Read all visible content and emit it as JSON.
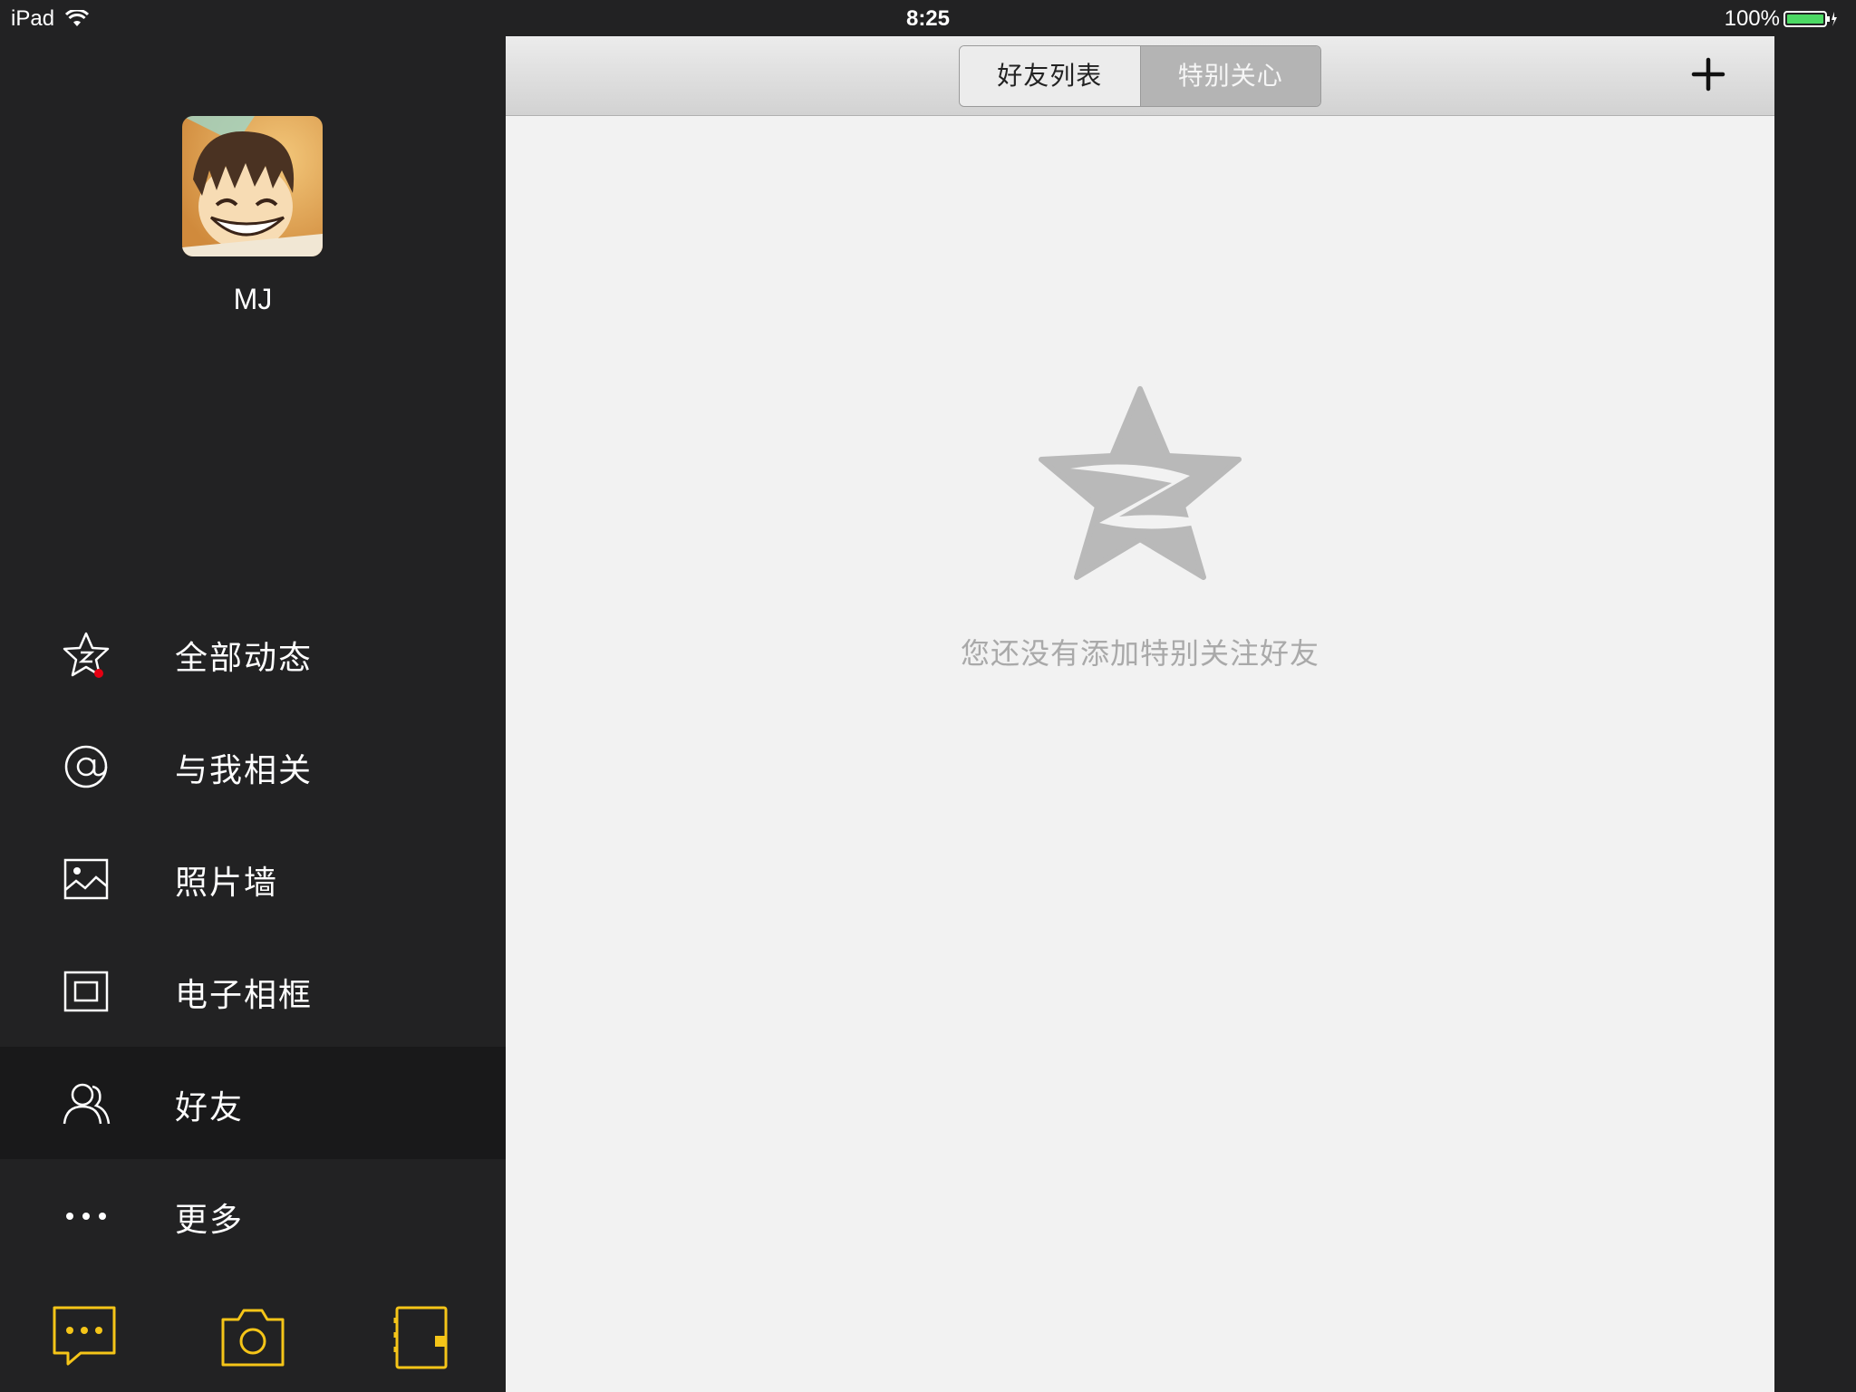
{
  "status_bar": {
    "device": "iPad",
    "time": "8:25",
    "battery": "100%"
  },
  "profile": {
    "name": "MJ"
  },
  "menu": [
    {
      "label": "全部动态",
      "icon": "qzone-star-icon",
      "badge": true
    },
    {
      "label": "与我相关",
      "icon": "at-icon"
    },
    {
      "label": "照片墙",
      "icon": "photo-icon"
    },
    {
      "label": "电子相框",
      "icon": "frame-icon"
    },
    {
      "label": "好友",
      "icon": "friends-icon",
      "active": true
    },
    {
      "label": "更多",
      "icon": "more-dots-icon"
    }
  ],
  "bottom_actions": [
    "compose-message-icon",
    "camera-icon",
    "notebook-icon"
  ],
  "tabs": {
    "friend_list": "好友列表",
    "special_care": "特别关心",
    "selected": "friend_list"
  },
  "empty_state": {
    "message": "您还没有添加特别关注好友"
  },
  "colors": {
    "accent": "#f5c518",
    "sidebar_bg": "#222223",
    "badge": "#e60012",
    "content_bg": "#f2f2f2"
  }
}
